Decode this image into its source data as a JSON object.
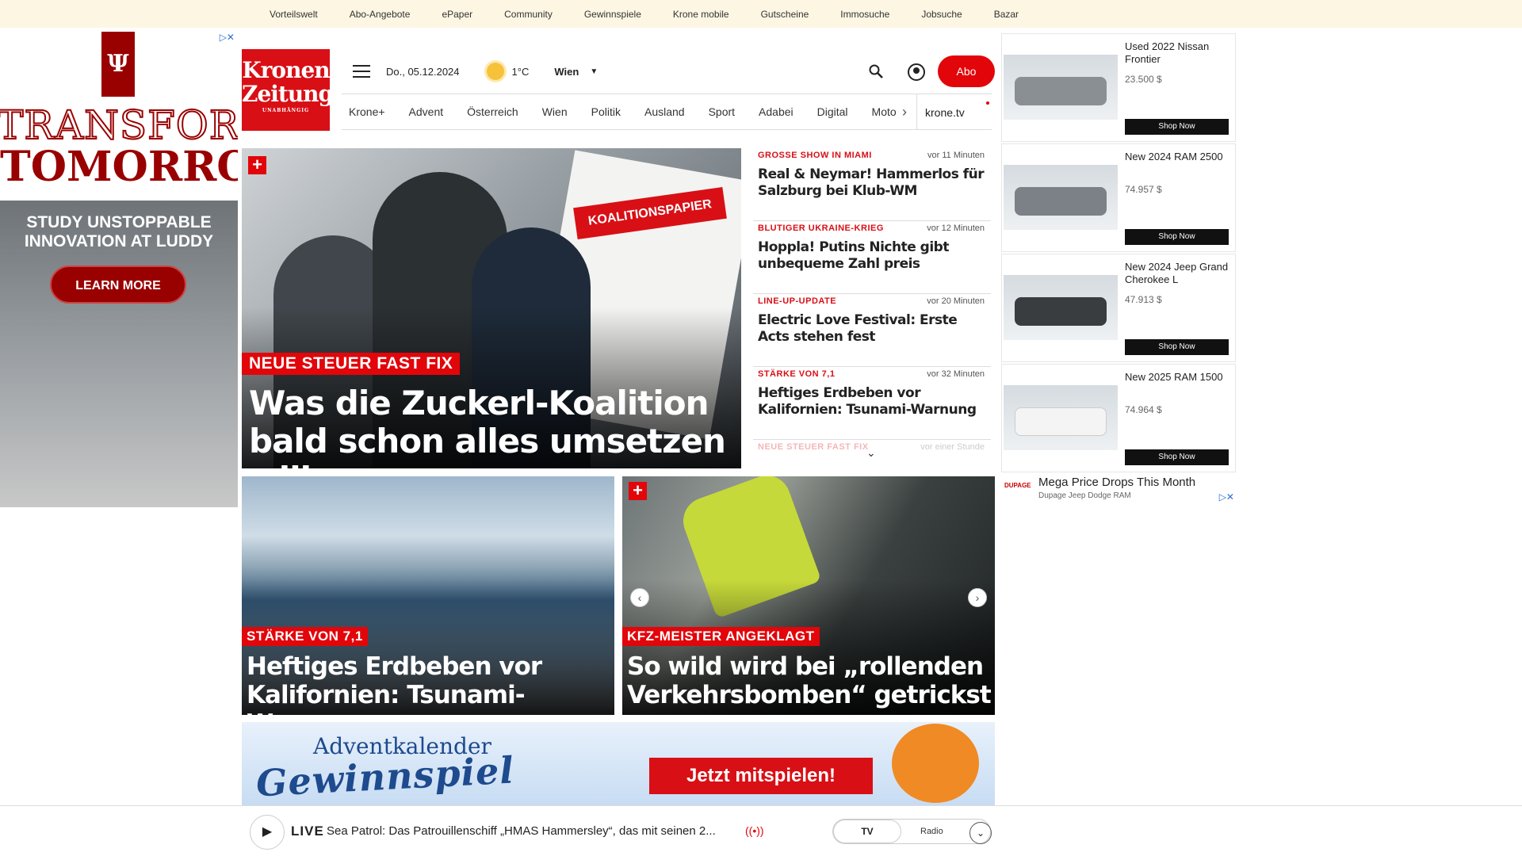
{
  "topbar": [
    "Vorteilswelt",
    "Abo-Angebote",
    "ePaper",
    "Community",
    "Gewinnspiele",
    "Krone mobile",
    "Gutscheine",
    "Immosuche",
    "Jobsuche",
    "Bazar"
  ],
  "ad_left": {
    "line1": "TRANSFORM",
    "line2": "TOMORROW",
    "study": "STUDY UNSTOPPABLE INNOVATION AT LUDDY",
    "cta": "LEARN MORE"
  },
  "header": {
    "logo_line1": "Kronen",
    "logo_line2": "Zeitung",
    "logo_line3": "UNABHÄNGIG",
    "date": "Do., 05.12.2024",
    "temp": "1°C",
    "city": "Wien",
    "abo": "Abo"
  },
  "nav": [
    "Krone+",
    "Advent",
    "Österreich",
    "Wien",
    "Politik",
    "Ausland",
    "Sport",
    "Adabei",
    "Digital",
    "Motor"
  ],
  "nav_tv": "krone.tv",
  "hero": {
    "paper_label": "KOALITIONSPAPIER",
    "kicker": "NEUE STEUER FAST FIX",
    "headline": "Was die Zuckerl-Koalition bald schon alles umsetzen will"
  },
  "news": [
    {
      "kicker": "GROSSE SHOW IN MIAMI",
      "time": "vor 11 Minuten",
      "title": "Real & Neymar! Hammerlos für Salzburg bei Klub-WM"
    },
    {
      "kicker": "BLUTIGER UKRAINE-KRIEG",
      "time": "vor 12 Minuten",
      "title": "Hoppla! Putins Nichte gibt unbequeme Zahl preis"
    },
    {
      "kicker": "LINE-UP-UPDATE",
      "time": "vor 20 Minuten",
      "title": "Electric Love Festival: Erste Acts stehen fest"
    },
    {
      "kicker": "STÄRKE VON 7,1",
      "time": "vor 32 Minuten",
      "title": "Heftiges Erdbeben vor Kalifornien: Tsunami-Warnung"
    },
    {
      "kicker": "NEUE STEUER FAST FIX",
      "time": "vor einer Stunde",
      "title": ""
    }
  ],
  "cards": [
    {
      "kicker": "STÄRKE VON 7,1",
      "title": "Heftiges Erdbeben vor Kalifornien: Tsunami-Warnung"
    },
    {
      "kicker": "KFZ-MEISTER ANGEKLAGT",
      "title": "So wild wird bei „rollenden Verkehrsbomben“ getrickst"
    }
  ],
  "banner": {
    "line1": "Adventkalender",
    "line2": "Gewinnspiel",
    "cta": "Jetzt mitspielen!"
  },
  "player": {
    "live": "LIVE",
    "title": "Sea Patrol: Das Patrouillenschiff „HMAS Hammersley“, das mit seinen 2...",
    "tv": "TV",
    "radio": "Radio"
  },
  "cars": [
    {
      "name": "Used 2022 Nissan Frontier",
      "price": "23.500 $",
      "shop": "Shop Now",
      "color": "#8a8f93"
    },
    {
      "name": "New 2024 RAM 2500",
      "price": "74.957 $",
      "shop": "Shop Now",
      "color": "#7b8187"
    },
    {
      "name": "New 2024 Jeep Grand Cherokee L",
      "price": "47.913 $",
      "shop": "Shop Now",
      "color": "#3a3d40"
    },
    {
      "name": "New 2025 RAM 1500",
      "price": "74.964 $",
      "shop": "Shop Now",
      "color": "#f4f4f4"
    }
  ],
  "sponsor": {
    "logo": "DUPAGE",
    "title": "Mega Price Drops This Month",
    "subtitle": "Dupage Jeep Dodge RAM"
  },
  "colors": {
    "brand_red": "#e2050a",
    "topbar_bg": "#fdf6e3"
  }
}
